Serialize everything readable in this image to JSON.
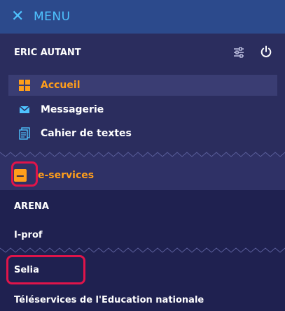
{
  "topbar": {
    "close_glyph": "✕",
    "menu_label": "MENU"
  },
  "user": {
    "name": "ERIC AUTANT",
    "settings_icon": "sliders-icon",
    "power_icon": "power-icon"
  },
  "nav": {
    "items": [
      {
        "label": "Accueil",
        "icon": "grid-icon"
      },
      {
        "label": "Messagerie",
        "icon": "envelope-icon"
      },
      {
        "label": "Cahier de textes",
        "icon": "notebook-icon"
      }
    ]
  },
  "eservices": {
    "toggle_glyph": "−",
    "label": "e-services",
    "items": [
      {
        "label": "ARENA"
      },
      {
        "label": "I-prof"
      },
      {
        "label": "Selia"
      },
      {
        "label": "Téléservices de l'Education nationale"
      }
    ]
  },
  "colors": {
    "accent": "#ff9e1b",
    "highlight": "#e0144a",
    "background": "#1f2150",
    "topbar": "#2c4a8c",
    "topbar_text": "#4fc3ff"
  }
}
